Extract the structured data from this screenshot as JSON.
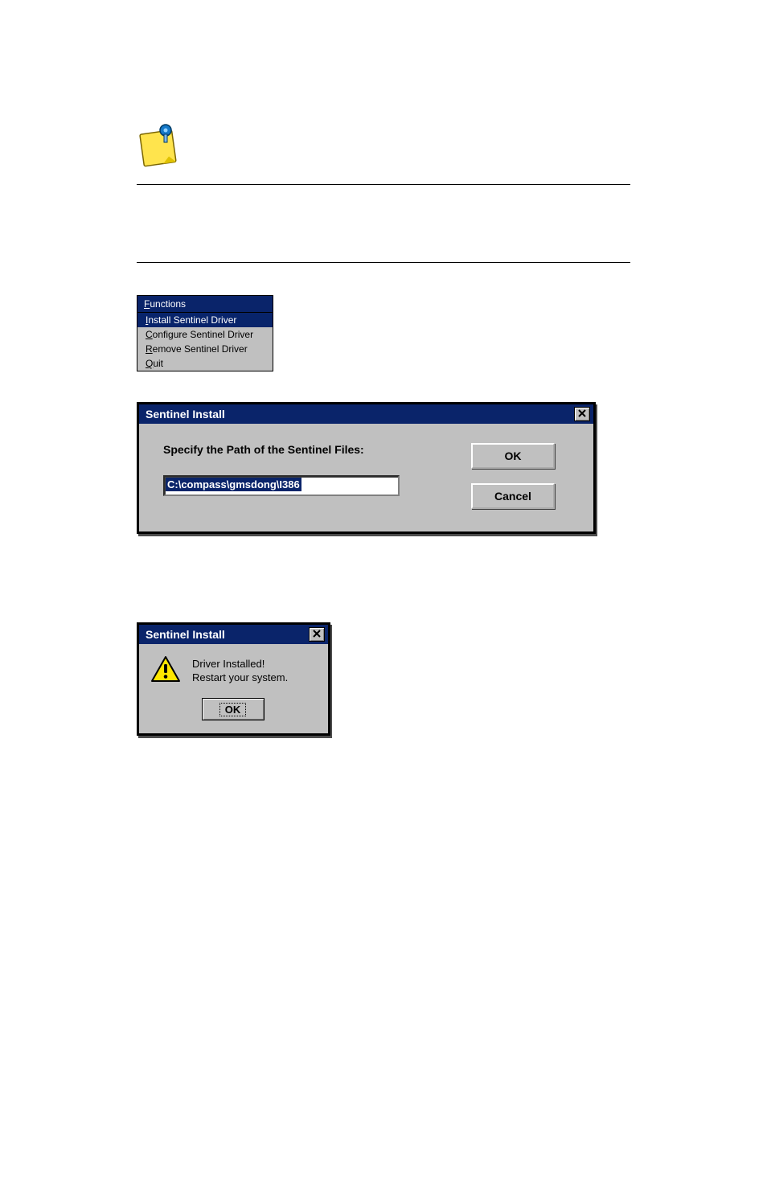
{
  "note": {
    "body": ""
  },
  "menu": {
    "title_pre_underline": "F",
    "title_rest": "unctions",
    "items": [
      {
        "pre": "I",
        "rest": "nstall Sentinel Driver",
        "selected": true
      },
      {
        "pre": "C",
        "rest": "onfigure Sentinel Driver",
        "selected": false
      },
      {
        "pre": "R",
        "rest": "emove Sentinel Driver",
        "selected": false
      },
      {
        "pre": "Q",
        "rest": "uit",
        "selected": false
      }
    ]
  },
  "dialog_path": {
    "title": "Sentinel Install",
    "label": "Specify the Path of the Sentinel Files:",
    "input_value": "C:\\compass\\gmsdong\\I386",
    "ok_label": "OK",
    "cancel_label": "Cancel"
  },
  "dialog_done": {
    "title": "Sentinel Install",
    "line1": "Driver Installed!",
    "line2": "Restart your system.",
    "ok_label": "OK"
  },
  "icons": {
    "note": "pinned-note-icon",
    "close": "close-icon",
    "warning": "warning-icon"
  }
}
